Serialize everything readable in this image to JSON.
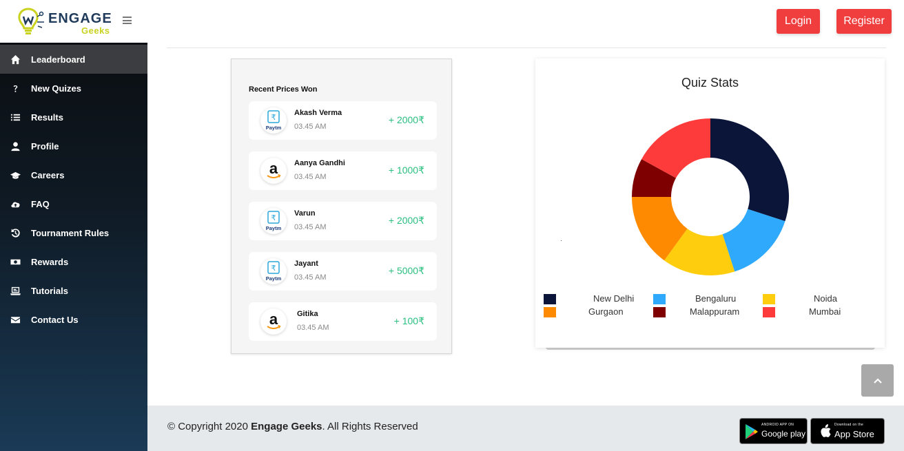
{
  "brand": {
    "line1": "ENGAGE",
    "line2": "Geeks"
  },
  "header": {
    "login_label": "Login",
    "register_label": "Register"
  },
  "sidebar": {
    "items": [
      {
        "label": "Leaderboard",
        "icon": "home-icon",
        "active": true
      },
      {
        "label": "New Quizes",
        "icon": "question-icon"
      },
      {
        "label": "Results",
        "icon": "list-icon"
      },
      {
        "label": "Profile",
        "icon": "user-icon"
      },
      {
        "label": "Careers",
        "icon": "graduation-cap-icon"
      },
      {
        "label": "FAQ",
        "icon": "cloud-upload-icon"
      },
      {
        "label": "Tournament Rules",
        "icon": "history-icon"
      },
      {
        "label": "Rewards",
        "icon": "money-icon"
      },
      {
        "label": "Tutorials",
        "icon": "laptop-icon"
      },
      {
        "label": "Contact Us",
        "icon": "envelope-icon"
      }
    ]
  },
  "prices": {
    "title": "Recent Prices Won",
    "rows": [
      {
        "name": "Akash Verma",
        "time": "03.45 AM",
        "amount": "+ 2000₹",
        "provider": "paytm-icon"
      },
      {
        "name": "Aanya Gandhi",
        "time": "03.45 AM",
        "amount": "+ 1000₹",
        "provider": "amazon-icon"
      },
      {
        "name": "Varun",
        "time": "03.45 AM",
        "amount": "+ 2000₹",
        "provider": "paytm-icon"
      },
      {
        "name": "Jayant",
        "time": "03.45 AM",
        "amount": "+ 5000₹",
        "provider": "paytm-icon"
      },
      {
        "name": "Gitika",
        "time": "03.45 AM",
        "amount": "+ 100₹",
        "provider": "amazon-icon"
      }
    ]
  },
  "stats": {
    "title": "Quiz Stats"
  },
  "chart_data": {
    "type": "pie",
    "donut": true,
    "title": "Quiz Stats",
    "categories": [
      "New Delhi",
      "Bengaluru",
      "Noida",
      "Gurgaon",
      "Malappuram",
      "Mumbai"
    ],
    "values": [
      30,
      15,
      15,
      15,
      8,
      17
    ],
    "colors": [
      "#0b1439",
      "#2ea9fb",
      "#fecd0e",
      "#fd8a00",
      "#7e0000",
      "#fd3b3b"
    ],
    "legend": "bottom"
  },
  "footer": {
    "copyright_prefix": "© Copyright 2020 ",
    "copyright_brand": "Engage Geeks",
    "copyright_suffix": ". All Rights Reserved",
    "google_play_small": "ANDROID APP ON",
    "google_play_big": "Google play",
    "app_store_small": "Download on the",
    "app_store_big": "App Store"
  }
}
